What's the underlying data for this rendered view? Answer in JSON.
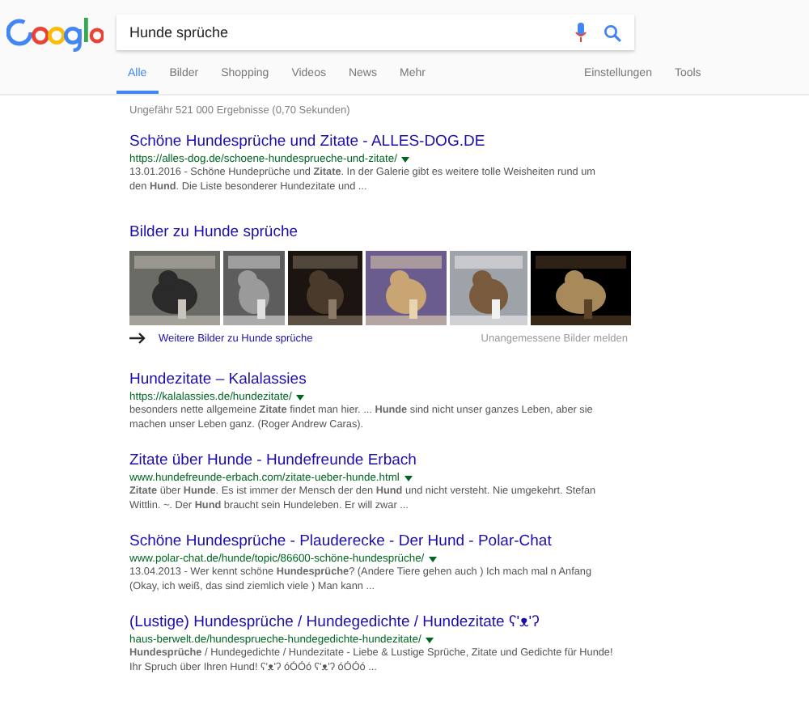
{
  "search": {
    "value": "Hunde sprüche"
  },
  "tabs": [
    {
      "label": "Alle",
      "selected": true
    },
    {
      "label": "Bilder",
      "selected": false
    },
    {
      "label": "Shopping",
      "selected": false
    },
    {
      "label": "Videos",
      "selected": false
    },
    {
      "label": "News",
      "selected": false
    },
    {
      "label": "Mehr",
      "selected": false
    }
  ],
  "tools": [
    "Einstellungen",
    "Tools"
  ],
  "stats": "Ungefähr 521 000 Ergebnisse (0,70 Sekunden)",
  "results_top": [
    {
      "title": "Schöne Hundesprüche und Zitate - ALLES-DOG.DE",
      "url": "https://alles-dog.de/schoene-hundesprueche-und-zitate/",
      "snippet": "13.01.2016 - Schöne Hundeprüche und **Zitate**. In der Galerie gibt es weitere tolle Weisheiten rund um den **Hund**. Die Liste besonderer Hundezitate und ..."
    }
  ],
  "images": {
    "title": "Bilder zu Hunde sprüche",
    "more_link": "Weitere Bilder zu Hunde sprüche",
    "report_link": "Unangemessene Bilder melden"
  },
  "results": [
    {
      "title": "Hundezitate – Kalalassies",
      "url": "https://kalalassies.de/hundezitate/",
      "snippet": "besonders nette allgemeine **Zitate** findet man hier. ... **Hunde** sind nicht unser ganzes Leben, aber sie machen unser Leben ganz. (Roger Andrew Caras)."
    },
    {
      "title": "Zitate über Hunde - Hundefreunde Erbach",
      "url": "www.hundefreunde-erbach.com/zitate-ueber-hunde.html",
      "snippet": "**Zitate** über **Hunde**. Es ist immer der Mensch der den **Hund** und nicht versteht. Nie umgekehrt. Stefan Wittlin. ~. Der **Hund** braucht sein Hundeleben. Er will zwar ..."
    },
    {
      "title": "Schöne Hundesprüche - Plauderecke - Der Hund - Polar-Chat",
      "url": "www.polar-chat.de/hunde/topic/86600-schöne-hundesprüche/",
      "snippet": "13.04.2013 - Wer kennt schöne **Hundesprüche**? (Andere Tiere gehen auch ) Ich mach mal n Anfang (Okay, ich weiß, das sind ziemlich viele ) Man kann ..."
    },
    {
      "title": "(Lustige) Hundesprüche / Hundegedichte / Hundezitate ʕ'ᴥ'ʔ",
      "url": "haus-berwelt.de/hundesprueche-hundegedichte-hundezitate/",
      "snippet": "**Hundesprüche** / Hundegedichte / Hundezitate - Liebe & Lustige Sprüche, Zitate und Gedichte für Hunde! Ihr Spruch über Ihren Hund! ʕ'ᴥ'ʔ óÓÓó ʕ'ᴥ'ʔ óÓÓó ..."
    }
  ]
}
